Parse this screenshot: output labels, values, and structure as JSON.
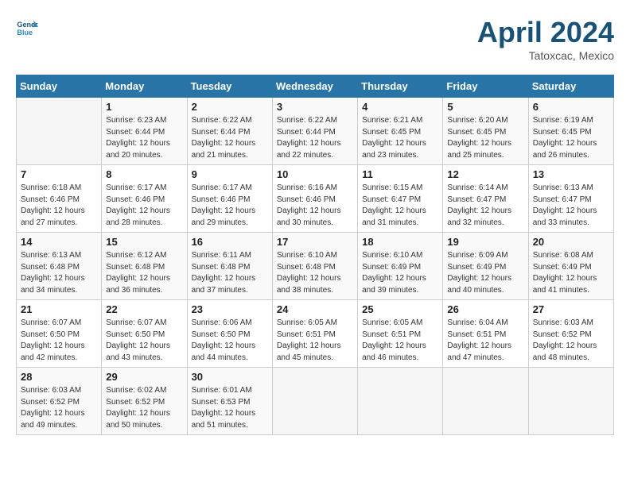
{
  "header": {
    "logo_general": "General",
    "logo_blue": "Blue",
    "month_title": "April 2024",
    "location": "Tatoxcac, Mexico"
  },
  "weekdays": [
    "Sunday",
    "Monday",
    "Tuesday",
    "Wednesday",
    "Thursday",
    "Friday",
    "Saturday"
  ],
  "weeks": [
    [
      {
        "day": "",
        "sunrise": "",
        "sunset": "",
        "daylight": ""
      },
      {
        "day": "1",
        "sunrise": "Sunrise: 6:23 AM",
        "sunset": "Sunset: 6:44 PM",
        "daylight": "Daylight: 12 hours and 20 minutes."
      },
      {
        "day": "2",
        "sunrise": "Sunrise: 6:22 AM",
        "sunset": "Sunset: 6:44 PM",
        "daylight": "Daylight: 12 hours and 21 minutes."
      },
      {
        "day": "3",
        "sunrise": "Sunrise: 6:22 AM",
        "sunset": "Sunset: 6:44 PM",
        "daylight": "Daylight: 12 hours and 22 minutes."
      },
      {
        "day": "4",
        "sunrise": "Sunrise: 6:21 AM",
        "sunset": "Sunset: 6:45 PM",
        "daylight": "Daylight: 12 hours and 23 minutes."
      },
      {
        "day": "5",
        "sunrise": "Sunrise: 6:20 AM",
        "sunset": "Sunset: 6:45 PM",
        "daylight": "Daylight: 12 hours and 25 minutes."
      },
      {
        "day": "6",
        "sunrise": "Sunrise: 6:19 AM",
        "sunset": "Sunset: 6:45 PM",
        "daylight": "Daylight: 12 hours and 26 minutes."
      }
    ],
    [
      {
        "day": "7",
        "sunrise": "Sunrise: 6:18 AM",
        "sunset": "Sunset: 6:46 PM",
        "daylight": "Daylight: 12 hours and 27 minutes."
      },
      {
        "day": "8",
        "sunrise": "Sunrise: 6:17 AM",
        "sunset": "Sunset: 6:46 PM",
        "daylight": "Daylight: 12 hours and 28 minutes."
      },
      {
        "day": "9",
        "sunrise": "Sunrise: 6:17 AM",
        "sunset": "Sunset: 6:46 PM",
        "daylight": "Daylight: 12 hours and 29 minutes."
      },
      {
        "day": "10",
        "sunrise": "Sunrise: 6:16 AM",
        "sunset": "Sunset: 6:46 PM",
        "daylight": "Daylight: 12 hours and 30 minutes."
      },
      {
        "day": "11",
        "sunrise": "Sunrise: 6:15 AM",
        "sunset": "Sunset: 6:47 PM",
        "daylight": "Daylight: 12 hours and 31 minutes."
      },
      {
        "day": "12",
        "sunrise": "Sunrise: 6:14 AM",
        "sunset": "Sunset: 6:47 PM",
        "daylight": "Daylight: 12 hours and 32 minutes."
      },
      {
        "day": "13",
        "sunrise": "Sunrise: 6:13 AM",
        "sunset": "Sunset: 6:47 PM",
        "daylight": "Daylight: 12 hours and 33 minutes."
      }
    ],
    [
      {
        "day": "14",
        "sunrise": "Sunrise: 6:13 AM",
        "sunset": "Sunset: 6:48 PM",
        "daylight": "Daylight: 12 hours and 34 minutes."
      },
      {
        "day": "15",
        "sunrise": "Sunrise: 6:12 AM",
        "sunset": "Sunset: 6:48 PM",
        "daylight": "Daylight: 12 hours and 36 minutes."
      },
      {
        "day": "16",
        "sunrise": "Sunrise: 6:11 AM",
        "sunset": "Sunset: 6:48 PM",
        "daylight": "Daylight: 12 hours and 37 minutes."
      },
      {
        "day": "17",
        "sunrise": "Sunrise: 6:10 AM",
        "sunset": "Sunset: 6:48 PM",
        "daylight": "Daylight: 12 hours and 38 minutes."
      },
      {
        "day": "18",
        "sunrise": "Sunrise: 6:10 AM",
        "sunset": "Sunset: 6:49 PM",
        "daylight": "Daylight: 12 hours and 39 minutes."
      },
      {
        "day": "19",
        "sunrise": "Sunrise: 6:09 AM",
        "sunset": "Sunset: 6:49 PM",
        "daylight": "Daylight: 12 hours and 40 minutes."
      },
      {
        "day": "20",
        "sunrise": "Sunrise: 6:08 AM",
        "sunset": "Sunset: 6:49 PM",
        "daylight": "Daylight: 12 hours and 41 minutes."
      }
    ],
    [
      {
        "day": "21",
        "sunrise": "Sunrise: 6:07 AM",
        "sunset": "Sunset: 6:50 PM",
        "daylight": "Daylight: 12 hours and 42 minutes."
      },
      {
        "day": "22",
        "sunrise": "Sunrise: 6:07 AM",
        "sunset": "Sunset: 6:50 PM",
        "daylight": "Daylight: 12 hours and 43 minutes."
      },
      {
        "day": "23",
        "sunrise": "Sunrise: 6:06 AM",
        "sunset": "Sunset: 6:50 PM",
        "daylight": "Daylight: 12 hours and 44 minutes."
      },
      {
        "day": "24",
        "sunrise": "Sunrise: 6:05 AM",
        "sunset": "Sunset: 6:51 PM",
        "daylight": "Daylight: 12 hours and 45 minutes."
      },
      {
        "day": "25",
        "sunrise": "Sunrise: 6:05 AM",
        "sunset": "Sunset: 6:51 PM",
        "daylight": "Daylight: 12 hours and 46 minutes."
      },
      {
        "day": "26",
        "sunrise": "Sunrise: 6:04 AM",
        "sunset": "Sunset: 6:51 PM",
        "daylight": "Daylight: 12 hours and 47 minutes."
      },
      {
        "day": "27",
        "sunrise": "Sunrise: 6:03 AM",
        "sunset": "Sunset: 6:52 PM",
        "daylight": "Daylight: 12 hours and 48 minutes."
      }
    ],
    [
      {
        "day": "28",
        "sunrise": "Sunrise: 6:03 AM",
        "sunset": "Sunset: 6:52 PM",
        "daylight": "Daylight: 12 hours and 49 minutes."
      },
      {
        "day": "29",
        "sunrise": "Sunrise: 6:02 AM",
        "sunset": "Sunset: 6:52 PM",
        "daylight": "Daylight: 12 hours and 50 minutes."
      },
      {
        "day": "30",
        "sunrise": "Sunrise: 6:01 AM",
        "sunset": "Sunset: 6:53 PM",
        "daylight": "Daylight: 12 hours and 51 minutes."
      },
      {
        "day": "",
        "sunrise": "",
        "sunset": "",
        "daylight": ""
      },
      {
        "day": "",
        "sunrise": "",
        "sunset": "",
        "daylight": ""
      },
      {
        "day": "",
        "sunrise": "",
        "sunset": "",
        "daylight": ""
      },
      {
        "day": "",
        "sunrise": "",
        "sunset": "",
        "daylight": ""
      }
    ]
  ]
}
